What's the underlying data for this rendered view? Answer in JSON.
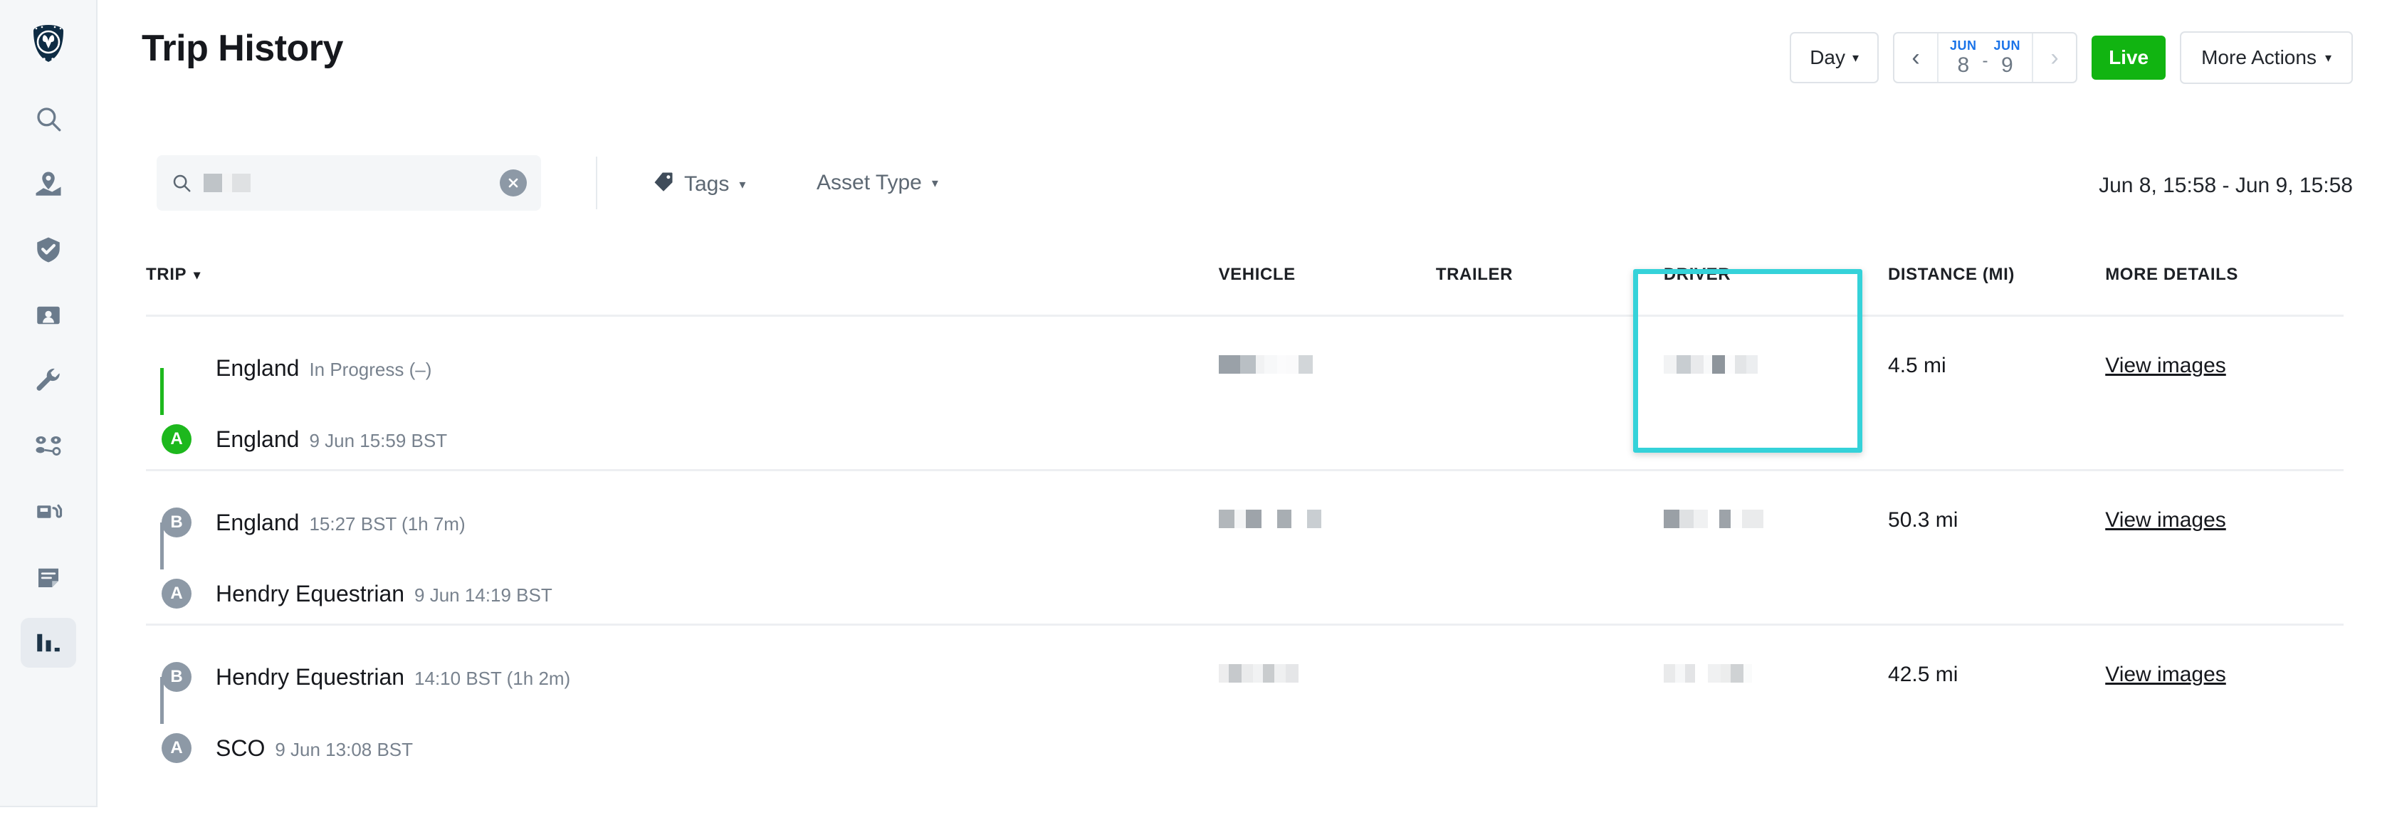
{
  "sidebar": {
    "logo_name": "owl-logo",
    "items": [
      {
        "name": "search-icon",
        "label": "Search",
        "active": false
      },
      {
        "name": "map-icon",
        "label": "Map",
        "active": false
      },
      {
        "name": "shield-check-icon",
        "label": "Safety",
        "active": false
      },
      {
        "name": "id-card-icon",
        "label": "Drivers",
        "active": false
      },
      {
        "name": "wrench-icon",
        "label": "Maintenance",
        "active": false
      },
      {
        "name": "connections-icon",
        "label": "Connections",
        "active": false
      },
      {
        "name": "fuel-pump-icon",
        "label": "Fuel",
        "active": false
      },
      {
        "name": "document-icon",
        "label": "Documents",
        "active": false
      },
      {
        "name": "bar-chart-icon",
        "label": "Reports",
        "active": true
      }
    ]
  },
  "header": {
    "title": "Trip History",
    "day_button": "Day",
    "caret": "▾",
    "date_nav": {
      "prev": "‹",
      "next": "›",
      "start_month": "JUN",
      "start_day": "8",
      "separator": "-",
      "end_month": "JUN",
      "end_day": "9"
    },
    "live_button": "Live",
    "more_actions": "More Actions"
  },
  "filters": {
    "search_placeholder": "",
    "search_value_redacted": true,
    "clear_icon": "close-icon",
    "tags_label": "Tags",
    "asset_type_label": "Asset Type",
    "caret": "▾",
    "range_label": "Jun 8, 15:58 - Jun 9, 15:58"
  },
  "table": {
    "columns": [
      {
        "key": "trip",
        "label": "TRIP",
        "sorted": true,
        "sort_caret": "▾"
      },
      {
        "key": "vehicle",
        "label": "VEHICLE"
      },
      {
        "key": "trailer",
        "label": "TRAILER"
      },
      {
        "key": "driver",
        "label": "DRIVER",
        "highlighted": true
      },
      {
        "key": "distance",
        "label": "DISTANCE (MI)"
      },
      {
        "key": "more",
        "label": "MORE DETAILS"
      }
    ],
    "rows": [
      {
        "legs": [
          {
            "badge": "",
            "badge_color": "none",
            "name": "England",
            "meta": "In Progress (–)"
          },
          {
            "badge": "A",
            "badge_color": "green",
            "name": "England",
            "meta": "9 Jun 15:59 BST"
          }
        ],
        "connector_color": "green",
        "vehicle_redacted": [
          {
            "w": 30,
            "c": "#9aa1a8"
          },
          {
            "w": 22,
            "c": "#b9bfc4"
          },
          {
            "w": 12,
            "c": "#f1f2f3"
          },
          {
            "w": 18,
            "c": "#f7f8f9"
          },
          {
            "w": 12,
            "c": "#fbfbfc"
          },
          {
            "w": 18,
            "c": "#fafafb"
          },
          {
            "w": 20,
            "c": "#d2d6d9"
          }
        ],
        "trailer_redacted": [],
        "driver_redacted": [
          {
            "w": 18,
            "c": "#f2f3f4"
          },
          {
            "w": 20,
            "c": "#c8cdd1"
          },
          {
            "w": 18,
            "c": "#e9eaec"
          },
          {
            "w": 12,
            "c": "#f8f9fa"
          },
          {
            "w": 18,
            "c": "#8e959c"
          },
          {
            "w": 14,
            "c": "#fcfcfd"
          },
          {
            "w": 16,
            "c": "#e3e5e7"
          },
          {
            "w": 16,
            "c": "#eceef0"
          }
        ],
        "distance": "4.5 mi",
        "more_details": "View images"
      },
      {
        "legs": [
          {
            "badge": "B",
            "badge_color": "gray",
            "name": "England",
            "meta": "15:27 BST (1h 7m)"
          },
          {
            "badge": "A",
            "badge_color": "gray",
            "name": "Hendry Equestrian",
            "meta": "9 Jun 14:19 BST"
          }
        ],
        "connector_color": "gray",
        "vehicle_redacted": [
          {
            "w": 22,
            "c": "#b2b7bb"
          },
          {
            "w": 16,
            "c": "#f4f5f6"
          },
          {
            "w": 22,
            "c": "#9ea4aa"
          },
          {
            "w": 22,
            "c": "#ffffff"
          },
          {
            "w": 20,
            "c": "#a8aeb3"
          },
          {
            "w": 22,
            "c": "#ffffff"
          },
          {
            "w": 20,
            "c": "#c9ced2"
          }
        ],
        "trailer_redacted": [],
        "driver_redacted": [
          {
            "w": 22,
            "c": "#9aa0a6"
          },
          {
            "w": 20,
            "c": "#dfe1e3"
          },
          {
            "w": 20,
            "c": "#f0f1f2"
          },
          {
            "w": 16,
            "c": "#ffffff"
          },
          {
            "w": 16,
            "c": "#9da3a9"
          },
          {
            "w": 16,
            "c": "#fdfdfd"
          },
          {
            "w": 30,
            "c": "#eaebec"
          }
        ],
        "distance": "50.3 mi",
        "more_details": "View images"
      },
      {
        "legs": [
          {
            "badge": "B",
            "badge_color": "gray",
            "name": "Hendry Equestrian",
            "meta": "14:10 BST (1h 2m)"
          },
          {
            "badge": "A",
            "badge_color": "gray",
            "name": "SCO",
            "meta": "9 Jun 13:08 BST"
          }
        ],
        "connector_color": "gray",
        "vehicle_redacted": [
          {
            "w": 14,
            "c": "#ededee"
          },
          {
            "w": 18,
            "c": "#c6c9cc"
          },
          {
            "w": 16,
            "c": "#eaebec"
          },
          {
            "w": 14,
            "c": "#f1f2f3"
          },
          {
            "w": 16,
            "c": "#c9ccce"
          },
          {
            "w": 16,
            "c": "#eff0f1"
          },
          {
            "w": 18,
            "c": "#e5e6e8"
          }
        ],
        "trailer_redacted": [],
        "driver_redacted": [
          {
            "w": 16,
            "c": "#e9eaeb"
          },
          {
            "w": 14,
            "c": "#f6f7f8"
          },
          {
            "w": 14,
            "c": "#e3e4e6"
          },
          {
            "w": 18,
            "c": "#ffffff"
          },
          {
            "w": 18,
            "c": "#f0f1f2"
          },
          {
            "w": 14,
            "c": "#eceded"
          },
          {
            "w": 18,
            "c": "#cfd2d4"
          },
          {
            "w": 12,
            "c": "#fafbfb"
          }
        ],
        "distance": "42.5 mi",
        "more_details": "View images"
      }
    ]
  },
  "colors": {
    "highlight": "#35d2d9",
    "live_green": "#11b411",
    "badge_green": "#1db81d",
    "badge_gray": "#8d99a6",
    "month_blue": "#1a73e8"
  }
}
